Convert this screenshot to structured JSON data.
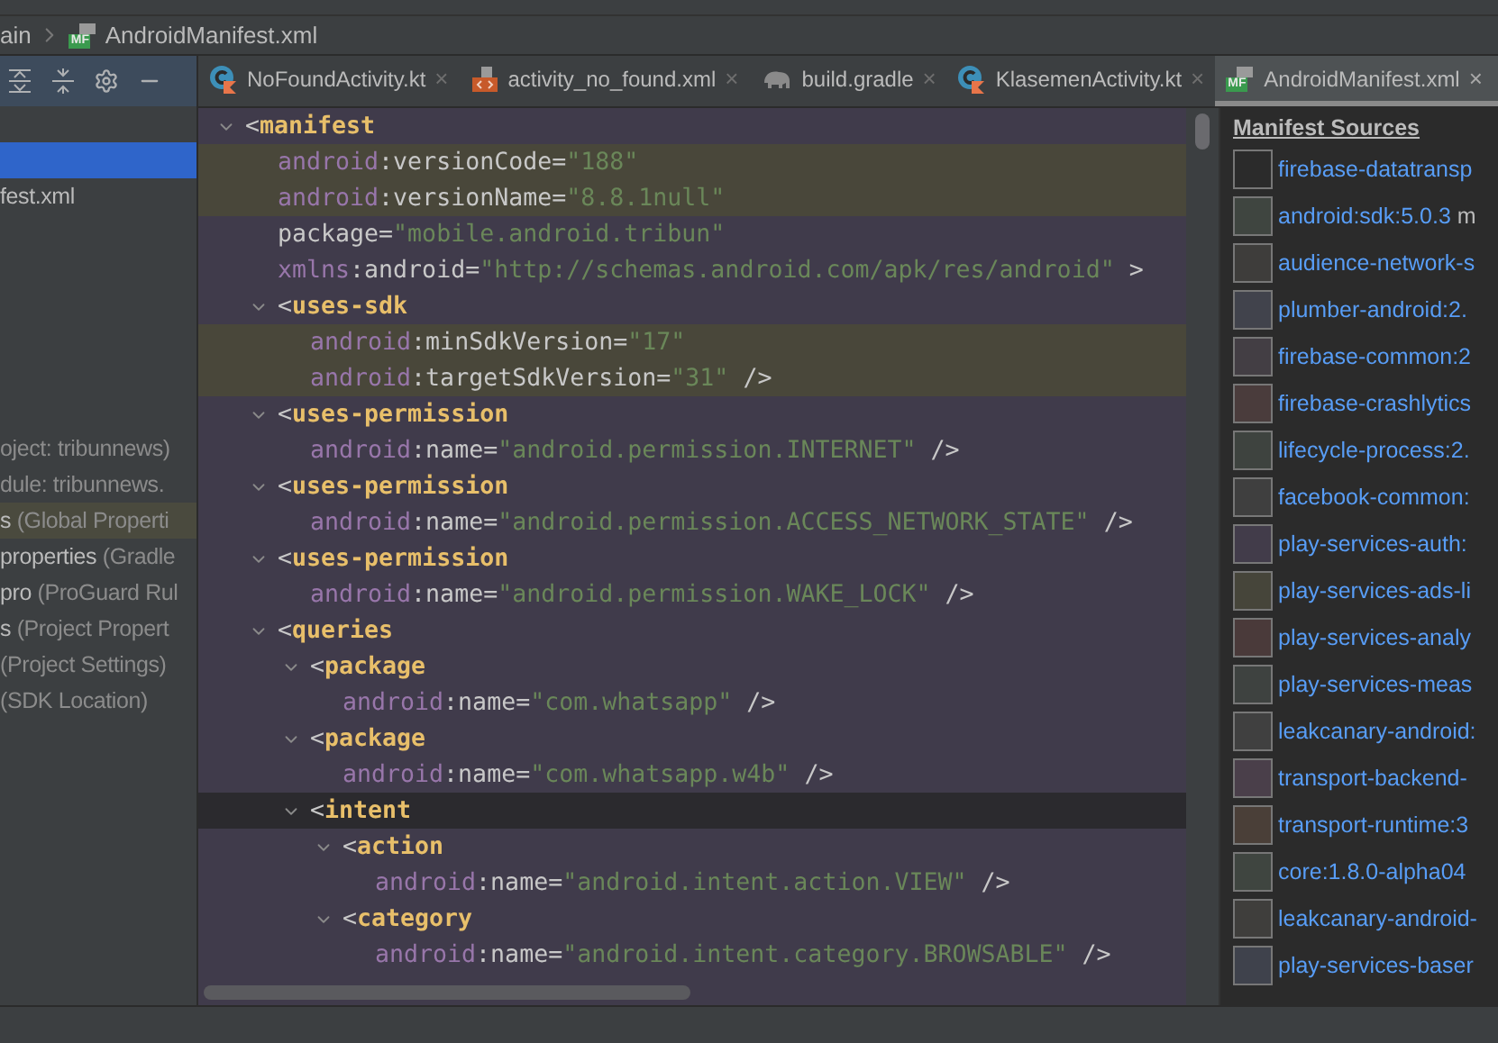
{
  "breadcrumb": [
    {
      "label": "ain",
      "kind": "folder"
    },
    {
      "label": "AndroidManifest.xml",
      "kind": "manifest",
      "icon_label": "MF"
    }
  ],
  "sidebar": {
    "files": [
      {
        "selected": true,
        "highlighted": false
      },
      {
        "name": "fest.xml",
        "selected": false,
        "highlighted": false
      }
    ],
    "items": [
      {
        "detail": "oject: tribunnews)",
        "selected": false,
        "highlighted": false
      },
      {
        "detail": "dule: tribunnews.",
        "selected": false,
        "highlighted": false
      },
      {
        "name": "s",
        "detail": " (Global Properti",
        "selected": false,
        "highlighted": true
      },
      {
        "name": "properties",
        "detail": " (Gradle",
        "selected": false,
        "highlighted": false
      },
      {
        "name": "pro",
        "detail": " (ProGuard Rul",
        "selected": false,
        "highlighted": false
      },
      {
        "name": "s",
        "detail": " (Project Propert",
        "selected": false,
        "highlighted": false
      },
      {
        "detail": "(Project Settings)",
        "selected": false,
        "highlighted": false
      },
      {
        "detail": " (SDK Location)",
        "selected": false,
        "highlighted": false
      }
    ]
  },
  "tabs": [
    {
      "label": "NoFoundActivity.kt",
      "kind": "kotlin",
      "close": "×",
      "selected": false
    },
    {
      "label": "activity_no_found.xml",
      "kind": "layout",
      "close": "×",
      "selected": false
    },
    {
      "label": "build.gradle",
      "kind": "gradle",
      "close": "×",
      "selected": false
    },
    {
      "label": "KlasemenActivity.kt",
      "kind": "kotlin",
      "close": "×",
      "selected": false
    },
    {
      "label": "AndroidManifest.xml",
      "kind": "manifest",
      "icon_label": "MF",
      "close": "×",
      "selected": true
    }
  ],
  "code": [
    {
      "tokens": [
        {
          "kind": "plain",
          "text": "<"
        },
        {
          "kind": "tag",
          "text": "manifest"
        }
      ],
      "fold": true,
      "highlighted": false,
      "current": false,
      "children": [
        {
          "tokens": [
            {
              "kind": "ns",
              "text": "android"
            },
            {
              "kind": "plain",
              "text": ":versionCode="
            },
            {
              "kind": "str",
              "text": "\"188\""
            }
          ],
          "fold": false,
          "highlighted": true,
          "current": false
        },
        {
          "tokens": [
            {
              "kind": "ns",
              "text": "android"
            },
            {
              "kind": "plain",
              "text": ":versionName="
            },
            {
              "kind": "str",
              "text": "\"8.8.1null\""
            }
          ],
          "fold": false,
          "highlighted": true,
          "current": false
        },
        {
          "tokens": [
            {
              "kind": "plain",
              "text": "package="
            },
            {
              "kind": "str",
              "text": "\"mobile.android.tribun\""
            }
          ],
          "fold": false,
          "highlighted": false,
          "current": false
        },
        {
          "tokens": [
            {
              "kind": "ns",
              "text": "xmlns"
            },
            {
              "kind": "plain",
              "text": ":android="
            },
            {
              "kind": "str",
              "text": "\"http://schemas.android.com/apk/res/android\""
            },
            {
              "kind": "plain",
              "text": " >"
            }
          ],
          "fold": false,
          "highlighted": false,
          "current": false
        },
        {
          "tokens": [
            {
              "kind": "plain",
              "text": "<"
            },
            {
              "kind": "tag",
              "text": "uses-sdk"
            }
          ],
          "fold": true,
          "highlighted": false,
          "current": false,
          "children": [
            {
              "tokens": [
                {
                  "kind": "ns",
                  "text": "android"
                },
                {
                  "kind": "plain",
                  "text": ":minSdkVersion="
                },
                {
                  "kind": "str",
                  "text": "\"17\""
                }
              ],
              "fold": false,
              "highlighted": true,
              "current": false
            },
            {
              "tokens": [
                {
                  "kind": "ns",
                  "text": "android"
                },
                {
                  "kind": "plain",
                  "text": ":targetSdkVersion="
                },
                {
                  "kind": "str",
                  "text": "\"31\""
                },
                {
                  "kind": "plain",
                  "text": " />"
                }
              ],
              "fold": false,
              "highlighted": true,
              "current": false
            }
          ]
        },
        {
          "tokens": [
            {
              "kind": "plain",
              "text": "<"
            },
            {
              "kind": "tag",
              "text": "uses-permission"
            }
          ],
          "fold": true,
          "highlighted": false,
          "current": false,
          "children": [
            {
              "tokens": [
                {
                  "kind": "ns",
                  "text": "android"
                },
                {
                  "kind": "plain",
                  "text": ":name="
                },
                {
                  "kind": "str",
                  "text": "\"android.permission.INTERNET\""
                },
                {
                  "kind": "plain",
                  "text": " />"
                }
              ],
              "fold": false,
              "highlighted": false,
              "current": false
            }
          ]
        },
        {
          "tokens": [
            {
              "kind": "plain",
              "text": "<"
            },
            {
              "kind": "tag",
              "text": "uses-permission"
            }
          ],
          "fold": true,
          "highlighted": false,
          "current": false,
          "children": [
            {
              "tokens": [
                {
                  "kind": "ns",
                  "text": "android"
                },
                {
                  "kind": "plain",
                  "text": ":name="
                },
                {
                  "kind": "str",
                  "text": "\"android.permission.ACCESS_NETWORK_STATE\""
                },
                {
                  "kind": "plain",
                  "text": " />"
                }
              ],
              "fold": false,
              "highlighted": false,
              "current": false
            }
          ]
        },
        {
          "tokens": [
            {
              "kind": "plain",
              "text": "<"
            },
            {
              "kind": "tag",
              "text": "uses-permission"
            }
          ],
          "fold": true,
          "highlighted": false,
          "current": false,
          "children": [
            {
              "tokens": [
                {
                  "kind": "ns",
                  "text": "android"
                },
                {
                  "kind": "plain",
                  "text": ":name="
                },
                {
                  "kind": "str",
                  "text": "\"android.permission.WAKE_LOCK\""
                },
                {
                  "kind": "plain",
                  "text": " />"
                }
              ],
              "fold": false,
              "highlighted": false,
              "current": false
            }
          ]
        },
        {
          "tokens": [
            {
              "kind": "plain",
              "text": "<"
            },
            {
              "kind": "tag",
              "text": "queries"
            }
          ],
          "fold": true,
          "highlighted": false,
          "current": false,
          "children": [
            {
              "tokens": [
                {
                  "kind": "plain",
                  "text": "<"
                },
                {
                  "kind": "tag",
                  "text": "package"
                }
              ],
              "fold": true,
              "highlighted": false,
              "current": false,
              "children": [
                {
                  "tokens": [
                    {
                      "kind": "ns",
                      "text": "android"
                    },
                    {
                      "kind": "plain",
                      "text": ":name="
                    },
                    {
                      "kind": "str",
                      "text": "\"com.whatsapp\""
                    },
                    {
                      "kind": "plain",
                      "text": " />"
                    }
                  ],
                  "fold": false,
                  "highlighted": false,
                  "current": false
                }
              ]
            },
            {
              "tokens": [
                {
                  "kind": "plain",
                  "text": "<"
                },
                {
                  "kind": "tag",
                  "text": "package"
                }
              ],
              "fold": true,
              "highlighted": false,
              "current": false,
              "children": [
                {
                  "tokens": [
                    {
                      "kind": "ns",
                      "text": "android"
                    },
                    {
                      "kind": "plain",
                      "text": ":name="
                    },
                    {
                      "kind": "str",
                      "text": "\"com.whatsapp.w4b\""
                    },
                    {
                      "kind": "plain",
                      "text": " />"
                    }
                  ],
                  "fold": false,
                  "highlighted": false,
                  "current": false
                }
              ]
            },
            {
              "tokens": [
                {
                  "kind": "plain",
                  "text": "<"
                },
                {
                  "kind": "tag",
                  "text": "intent"
                }
              ],
              "fold": true,
              "highlighted": false,
              "current": true,
              "children": [
                {
                  "tokens": [
                    {
                      "kind": "plain",
                      "text": "<"
                    },
                    {
                      "kind": "tag",
                      "text": "action"
                    }
                  ],
                  "fold": true,
                  "highlighted": false,
                  "current": false,
                  "children": [
                    {
                      "tokens": [
                        {
                          "kind": "ns",
                          "text": "android"
                        },
                        {
                          "kind": "plain",
                          "text": ":name="
                        },
                        {
                          "kind": "str",
                          "text": "\"android.intent.action.VIEW\""
                        },
                        {
                          "kind": "plain",
                          "text": " />"
                        }
                      ],
                      "fold": false,
                      "highlighted": false,
                      "current": false
                    }
                  ]
                },
                {
                  "tokens": [
                    {
                      "kind": "plain",
                      "text": "<"
                    },
                    {
                      "kind": "tag",
                      "text": "category"
                    }
                  ],
                  "fold": true,
                  "highlighted": false,
                  "current": false,
                  "children": [
                    {
                      "tokens": [
                        {
                          "kind": "ns",
                          "text": "android"
                        },
                        {
                          "kind": "plain",
                          "text": ":name="
                        },
                        {
                          "kind": "str",
                          "text": "\"android.intent.category.BROWSABLE\""
                        },
                        {
                          "kind": "plain",
                          "text": " />"
                        }
                      ],
                      "fold": false,
                      "highlighted": false,
                      "current": false
                    }
                  ]
                }
              ]
            }
          ]
        }
      ]
    }
  ],
  "manifest_sources": {
    "title": "Manifest Sources",
    "items": [
      {
        "name": "firebase-datatransp",
        "color": "#2b2b2b"
      },
      {
        "name": "android:sdk:5.0.3",
        "detail": " m",
        "color": "#3f4540"
      },
      {
        "name": "audience-network-s",
        "color": "#3e3d3b"
      },
      {
        "name": "plumber-android:2.",
        "color": "#41434c"
      },
      {
        "name": "firebase-common:2",
        "color": "#433e44"
      },
      {
        "name": "firebase-crashlytics",
        "color": "#4a3c3c"
      },
      {
        "name": "lifecycle-process:2.",
        "color": "#3e433f"
      },
      {
        "name": "facebook-common:",
        "color": "#3f3f3f"
      },
      {
        "name": "play-services-auth:",
        "color": "#423c4a"
      },
      {
        "name": "play-services-ads-li",
        "color": "#46453a"
      },
      {
        "name": "play-services-analy",
        "color": "#4a3a3a"
      },
      {
        "name": "play-services-meas",
        "color": "#3e4240"
      },
      {
        "name": "leakcanary-android:",
        "color": "#404040"
      },
      {
        "name": "transport-backend-",
        "color": "#4a3f4a"
      },
      {
        "name": "transport-runtime:3",
        "color": "#4a3f38"
      },
      {
        "name": "core:1.8.0-alpha04",
        "color": "#3f4540"
      },
      {
        "name": "leakcanary-android-",
        "color": "#3f3e3c"
      },
      {
        "name": "play-services-baser",
        "color": "#3f424c"
      }
    ]
  }
}
